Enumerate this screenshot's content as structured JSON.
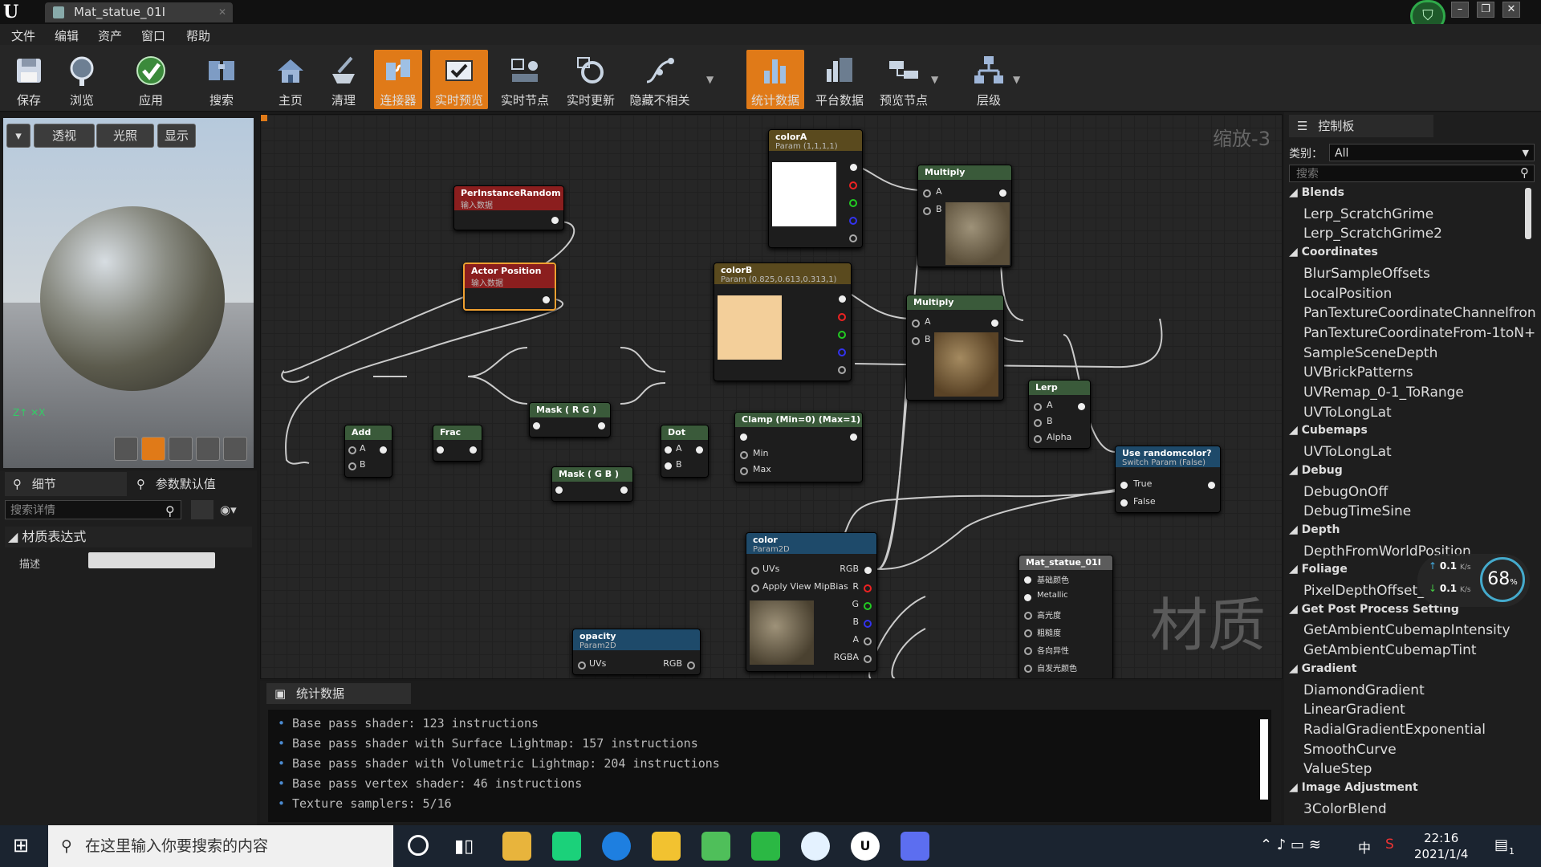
{
  "title_bar": {
    "tab_title": "Mat_statue_01I"
  },
  "menu": [
    "文件",
    "编辑",
    "资产",
    "窗口",
    "帮助"
  ],
  "toolbar": [
    {
      "label": "保存",
      "icon": "save-icon",
      "active": false
    },
    {
      "label": "浏览",
      "icon": "browse-icon",
      "active": false
    },
    {
      "label": "应用",
      "icon": "apply-icon",
      "active": false
    },
    {
      "label": "搜索",
      "icon": "search-icon",
      "active": false
    },
    {
      "label": "主页",
      "icon": "home-icon",
      "active": false
    },
    {
      "label": "清理",
      "icon": "clean-icon",
      "active": false
    },
    {
      "label": "连接器",
      "icon": "connector-icon",
      "active": true
    },
    {
      "label": "实时预览",
      "icon": "live-preview-icon",
      "active": true
    },
    {
      "label": "实时节点",
      "icon": "live-nodes-icon",
      "active": false
    },
    {
      "label": "实时更新",
      "icon": "live-update-icon",
      "active": false
    },
    {
      "label": "隐藏不相关",
      "icon": "hide-unrelated-icon",
      "active": false
    },
    {
      "label": "统计数据",
      "icon": "stats-icon",
      "active": true
    },
    {
      "label": "平台数据",
      "icon": "platform-stats-icon",
      "active": false
    },
    {
      "label": "预览节点",
      "icon": "preview-node-icon",
      "active": false
    },
    {
      "label": "层级",
      "icon": "hierarchy-icon",
      "active": false
    }
  ],
  "viewport": {
    "perspective": "透视",
    "lit": "光照",
    "show": "显示"
  },
  "details": {
    "tab_details": "细节",
    "tab_params": "参数默认值",
    "search_placeholder": "搜索详情",
    "section": "材质表达式",
    "description_label": "描述"
  },
  "graph": {
    "zoom": "缩放-3",
    "watermark": "材质",
    "nodes": {
      "per_instance_random": {
        "title": "PerInstanceRandom",
        "sub": "输入数据"
      },
      "actor_position": {
        "title": "Actor Position",
        "sub": "输入数据"
      },
      "colorA": {
        "title": "colorA",
        "sub": "Param (1,1,1,1)"
      },
      "colorB": {
        "title": "colorB",
        "sub": "Param (0.825,0.613,0.313,1)"
      },
      "multiply1": {
        "title": "Multiply",
        "a": "A",
        "b": "B"
      },
      "multiply2": {
        "title": "Multiply",
        "a": "A",
        "b": "B"
      },
      "lerp": {
        "title": "Lerp",
        "a": "A",
        "b": "B",
        "alpha": "Alpha"
      },
      "add": {
        "title": "Add",
        "a": "A",
        "b": "B"
      },
      "frac": {
        "title": "Frac"
      },
      "mask_rg": {
        "title": "Mask ( R G )"
      },
      "mask_gb": {
        "title": "Mask ( G B )"
      },
      "dot": {
        "title": "Dot",
        "a": "A",
        "b": "B"
      },
      "clamp": {
        "title": "Clamp (Min=0) (Max=1)",
        "min": "Min",
        "max": "Max"
      },
      "switch": {
        "title": "Use randomcolor?",
        "sub": "Switch Param (False)",
        "true": "True",
        "false": "False"
      },
      "color_tex": {
        "title": "color",
        "sub": "Param2D",
        "uvs": "UVs",
        "mip": "Apply View MipBias",
        "rgb": "RGB",
        "r": "R",
        "g": "G",
        "b": "B",
        "a": "A",
        "rgba": "RGBA"
      },
      "opacity_tex": {
        "title": "opacity",
        "sub": "Param2D",
        "uvs": "UVs",
        "rgb": "RGB"
      },
      "material": {
        "title": "Mat_statue_01I",
        "pins": [
          "基础颜色",
          "Metallic",
          "高光度",
          "粗糙度",
          "各向异性",
          "自发光颜色"
        ]
      }
    }
  },
  "stats": {
    "tab": "统计数据",
    "lines": [
      "Base pass shader: 123 instructions",
      "Base pass shader with Surface Lightmap: 157 instructions",
      "Base pass shader with Volumetric Lightmap: 204 instructions",
      "Base pass vertex shader: 46 instructions",
      "Texture samplers: 5/16"
    ]
  },
  "palette": {
    "tab": "控制板",
    "category_label": "类别：",
    "category_value": "All",
    "search_placeholder": "搜索",
    "items": [
      {
        "type": "cat",
        "text": "Blends"
      },
      {
        "type": "item",
        "text": "Lerp_ScratchGrime"
      },
      {
        "type": "item",
        "text": "Lerp_ScratchGrime2"
      },
      {
        "type": "cat",
        "text": "Coordinates"
      },
      {
        "type": "item",
        "text": "BlurSampleOffsets"
      },
      {
        "type": "item",
        "text": "LocalPosition"
      },
      {
        "type": "item",
        "text": "PanTextureCoordinateChannelfron"
      },
      {
        "type": "item",
        "text": "PanTextureCoordinateFrom-1toN+"
      },
      {
        "type": "item",
        "text": "SampleSceneDepth"
      },
      {
        "type": "item",
        "text": "UVBrickPatterns"
      },
      {
        "type": "item",
        "text": "UVRemap_0-1_ToRange"
      },
      {
        "type": "item",
        "text": "UVToLongLat"
      },
      {
        "type": "cat",
        "text": "Cubemaps"
      },
      {
        "type": "item",
        "text": "UVToLongLat"
      },
      {
        "type": "cat",
        "text": "Debug"
      },
      {
        "type": "item",
        "text": "DebugOnOff"
      },
      {
        "type": "item",
        "text": "DebugTimeSine"
      },
      {
        "type": "cat",
        "text": "Depth"
      },
      {
        "type": "item",
        "text": "DepthFromWorldPosition"
      },
      {
        "type": "cat",
        "text": "Foliage"
      },
      {
        "type": "item",
        "text": "PixelDepthOffset_"
      },
      {
        "type": "cat",
        "text": "Get Post Process Setting"
      },
      {
        "type": "item",
        "text": "GetAmbientCubemapIntensity"
      },
      {
        "type": "item",
        "text": "GetAmbientCubemapTint"
      },
      {
        "type": "cat",
        "text": "Gradient"
      },
      {
        "type": "item",
        "text": "DiamondGradient"
      },
      {
        "type": "item",
        "text": "LinearGradient"
      },
      {
        "type": "item",
        "text": "RadialGradientExponential"
      },
      {
        "type": "item",
        "text": "SmoothCurve"
      },
      {
        "type": "item",
        "text": "ValueStep"
      },
      {
        "type": "cat",
        "text": "Image Adjustment"
      },
      {
        "type": "item",
        "text": "3ColorBlend"
      }
    ]
  },
  "net_widget": {
    "up": "0.1",
    "down": "0.1",
    "unit": "K/s",
    "percent": "68",
    "percent_unit": "%"
  },
  "taskbar": {
    "search_placeholder": "在这里输入你要搜索的内容",
    "time": "22:16",
    "date": "2021/1/4",
    "ime": "中",
    "notif_count": "1"
  }
}
